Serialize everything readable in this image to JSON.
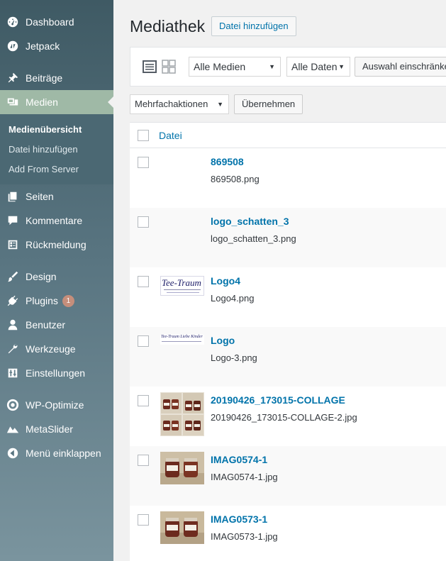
{
  "sidebar": {
    "menu": [
      {
        "label": "Dashboard",
        "icon": "dashboard-icon"
      },
      {
        "label": "Jetpack",
        "icon": "jetpack-icon"
      },
      {
        "label": "Beiträge",
        "icon": "pin-icon"
      },
      {
        "label": "Medien",
        "icon": "media-icon",
        "active": true
      },
      {
        "label": "Seiten",
        "icon": "pages-icon"
      },
      {
        "label": "Kommentare",
        "icon": "comments-icon"
      },
      {
        "label": "Rückmeldung",
        "icon": "feedback-icon"
      },
      {
        "label": "Design",
        "icon": "brush-icon"
      },
      {
        "label": "Plugins",
        "icon": "plugin-icon",
        "badge": "1"
      },
      {
        "label": "Benutzer",
        "icon": "user-icon"
      },
      {
        "label": "Werkzeuge",
        "icon": "wrench-icon"
      },
      {
        "label": "Einstellungen",
        "icon": "settings-icon"
      },
      {
        "label": "WP-Optimize",
        "icon": "wp-optimize-icon"
      },
      {
        "label": "MetaSlider",
        "icon": "metaslider-icon"
      },
      {
        "label": "Menü einklappen",
        "icon": "collapse-icon"
      }
    ],
    "submenu": [
      {
        "label": "Medienübersicht",
        "current": true
      },
      {
        "label": "Datei hinzufügen"
      },
      {
        "label": "Add From Server"
      }
    ]
  },
  "header": {
    "title": "Mediathek",
    "add_button": "Datei hinzufügen"
  },
  "toolbar": {
    "media_filter": "Alle Medien",
    "date_filter": "Alle Daten",
    "bulk_select_button": "Auswahl einschränken"
  },
  "bulk": {
    "action_select": "Mehrfachaktionen",
    "apply_button": "Übernehmen"
  },
  "table": {
    "column_file": "Datei",
    "rows": [
      {
        "title": "869508",
        "filename": "869508.png",
        "thumb": "blank"
      },
      {
        "title": "logo_schatten_3",
        "filename": "logo_schatten_3.png",
        "thumb": "blank"
      },
      {
        "title": "Logo4",
        "filename": "Logo4.png",
        "thumb": "logo-large",
        "thumb_text": "Tee-Traum"
      },
      {
        "title": "Logo",
        "filename": "Logo-3.png",
        "thumb": "logo-small",
        "thumb_text": "Tee-Traum Liebe Kinder"
      },
      {
        "title": "20190426_173015-COLLAGE",
        "filename": "20190426_173015-COLLAGE-2.jpg",
        "thumb": "collage"
      },
      {
        "title": "IMAG0574-1",
        "filename": "IMAG0574-1.jpg",
        "thumb": "jars"
      },
      {
        "title": "IMAG0573-1",
        "filename": "IMAG0573-1.jpg",
        "thumb": "jars"
      }
    ]
  },
  "colors": {
    "link": "#0073aa",
    "sidebar_active": "#9fb9a6",
    "badge": "#c58e7b"
  }
}
